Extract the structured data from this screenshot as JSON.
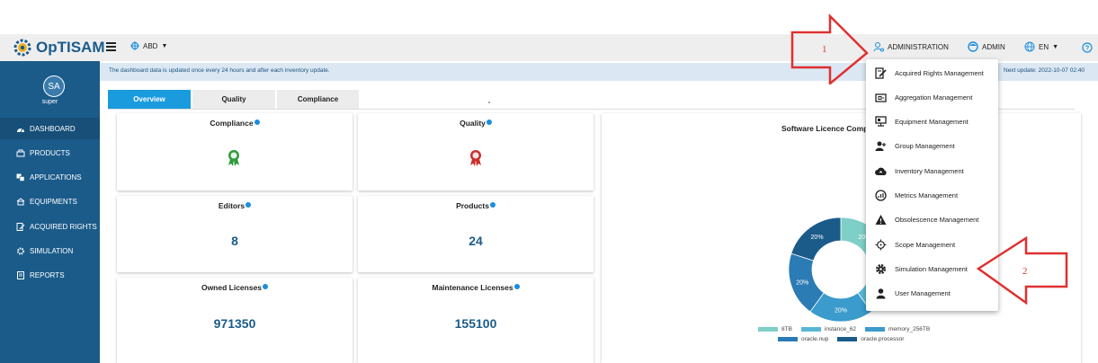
{
  "app": {
    "logo_text": "OpTISAM"
  },
  "header": {
    "scope_label": "ABD",
    "admin_menu_label": "ADMINISTRATION",
    "user_label": "ADMIN",
    "language_label": "EN"
  },
  "sidebar": {
    "avatar_initials": "SA",
    "user_name": "super",
    "items": [
      {
        "label": "DASHBOARD",
        "icon": "dashboard-icon"
      },
      {
        "label": "PRODUCTS",
        "icon": "products-icon"
      },
      {
        "label": "APPLICATIONS",
        "icon": "applications-icon"
      },
      {
        "label": "EQUIPMENTS",
        "icon": "equipments-icon"
      },
      {
        "label": "ACQUIRED RIGHTS",
        "icon": "acquired-rights-icon"
      },
      {
        "label": "SIMULATION",
        "icon": "simulation-icon"
      },
      {
        "label": "REPORTS",
        "icon": "reports-icon"
      }
    ]
  },
  "info_bar": {
    "text": "The dashboard data is updated once every 24 hours and after each inventory update.",
    "next_update": "Next update: 2022-10-07 02:40"
  },
  "tabs": [
    {
      "label": "Overview",
      "active": true
    },
    {
      "label": "Quality",
      "active": false
    },
    {
      "label": "Compliance",
      "active": false
    }
  ],
  "cards": {
    "compliance": {
      "title": "Compliance"
    },
    "quality": {
      "title": "Quality"
    },
    "editors": {
      "title": "Editors",
      "value": "8"
    },
    "products": {
      "title": "Products",
      "value": "24"
    },
    "owned_licenses": {
      "title": "Owned Licenses",
      "value": "971350"
    },
    "maintenance_licenses": {
      "title": "Maintenance Licenses",
      "value": "155100"
    }
  },
  "chart": {
    "title": "Software Licence Comp",
    "slice_labels": [
      "20%",
      "20%",
      "20%",
      "20%",
      "20%"
    ],
    "legend": [
      {
        "label": "8TB",
        "color": "#7ecfc7"
      },
      {
        "label": "instance_62",
        "color": "#58b6d6"
      },
      {
        "label": "memory_256TB",
        "color": "#3a9bcc"
      },
      {
        "label": "oracle.nup",
        "color": "#2b7bb5"
      },
      {
        "label": "oracle.processor",
        "color": "#1b5b8a"
      }
    ]
  },
  "admin_dropdown": {
    "items": [
      {
        "label": "Acquired Rights Management",
        "icon": "acquired-rights-icon"
      },
      {
        "label": "Aggregation Management",
        "icon": "aggregation-icon"
      },
      {
        "label": "Equipment Management",
        "icon": "equipment-icon"
      },
      {
        "label": "Group Management",
        "icon": "group-icon"
      },
      {
        "label": "Inventory Management",
        "icon": "cloud-upload-icon"
      },
      {
        "label": "Metrics Management",
        "icon": "metrics-icon"
      },
      {
        "label": "Obsolescence Management",
        "icon": "warning-icon"
      },
      {
        "label": "Scope Management",
        "icon": "scope-icon"
      },
      {
        "label": "Simulation Management",
        "icon": "gear-icon"
      },
      {
        "label": "User Management",
        "icon": "user-icon"
      }
    ]
  },
  "annotations": {
    "step1": "1",
    "step2": "2",
    "color": "#e03030"
  },
  "colors": {
    "primary": "#1b5b8a",
    "accent": "#1a9bde"
  }
}
